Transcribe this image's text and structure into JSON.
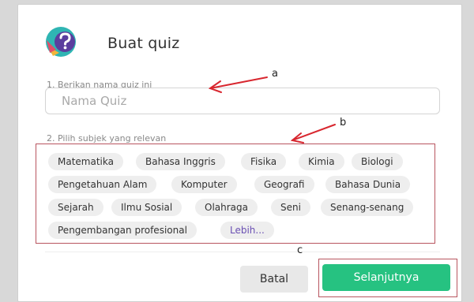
{
  "dialog": {
    "title": "Buat quiz",
    "logo_icon": "question-mark-logo-icon"
  },
  "step1": {
    "label": "1. Berikan nama quiz ini",
    "input_value": "",
    "input_placeholder": "Nama Quiz"
  },
  "step2": {
    "label": "2. Pilih subjek yang relevan",
    "subjects": [
      "Matematika",
      "Bahasa Inggris",
      "Fisika",
      "Kimia",
      "Biologi",
      "Pengetahuan Alam",
      "Komputer",
      "Geografi",
      "Bahasa Dunia",
      "Sejarah",
      "Ilmu Sosial",
      "Olahraga",
      "Seni",
      "Senang-senang",
      "Pengembangan profesional"
    ],
    "more_label": "Lebih..."
  },
  "actions": {
    "cancel_label": "Batal",
    "next_label": "Selanjutnya"
  },
  "annotations": {
    "a": "a",
    "b": "b",
    "c": "c"
  },
  "colors": {
    "accent_green": "#26c281",
    "highlight_red": "#b8555f",
    "more_link": "#6a4fb3"
  }
}
